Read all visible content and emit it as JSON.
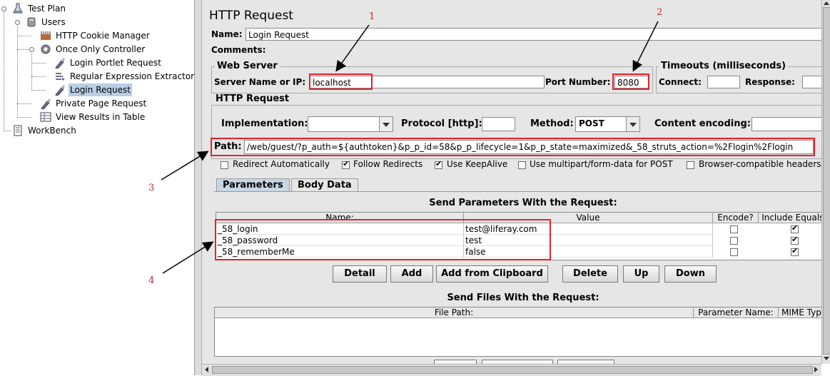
{
  "tree": {
    "items": [
      {
        "label": "Test Plan",
        "icon": "test-plan-icon"
      },
      {
        "label": "Users",
        "icon": "thread-group-icon"
      },
      {
        "label": "HTTP Cookie Manager",
        "icon": "cookie-manager-icon"
      },
      {
        "label": "Once Only Controller",
        "icon": "controller-icon"
      },
      {
        "label": "Login Portlet Request",
        "icon": "sampler-icon"
      },
      {
        "label": "Regular Expression Extractor",
        "icon": "extractor-icon"
      },
      {
        "label": "Login Request",
        "icon": "sampler-icon",
        "selected": true
      },
      {
        "label": "Private Page Request",
        "icon": "sampler-icon"
      },
      {
        "label": "View Results in Table",
        "icon": "listener-icon"
      },
      {
        "label": "WorkBench",
        "icon": "workbench-icon"
      }
    ]
  },
  "panel": {
    "title": "HTTP Request",
    "name_label": "Name:",
    "name_value": "Login Request",
    "comments_label": "Comments:",
    "web_server": {
      "title": "Web Server",
      "server_label": "Server Name or IP:",
      "server_value": "localhost",
      "port_label": "Port Number:",
      "port_value": "8080"
    },
    "timeouts": {
      "title": "Timeouts (milliseconds)",
      "connect_label": "Connect:",
      "response_label": "Response:"
    },
    "http_request": {
      "title": "HTTP Request",
      "impl_label": "Implementation:",
      "protocol_label": "Protocol [http]:",
      "method_label": "Method:",
      "method_value": "POST",
      "encoding_label": "Content encoding:",
      "path_label": "Path:",
      "path_value": "/web/guest/?p_auth=${authtoken}&p_p_id=58&p_p_lifecycle=1&p_p_state=maximized&_58_struts_action=%2Flogin%2Flogin"
    },
    "options": [
      {
        "label": "Redirect Automatically",
        "checked": false
      },
      {
        "label": "Follow Redirects",
        "checked": true
      },
      {
        "label": "Use KeepAlive",
        "checked": true
      },
      {
        "label": "Use multipart/form-data for POST",
        "checked": false
      },
      {
        "label": "Browser-compatible headers",
        "checked": false
      }
    ],
    "tabs": [
      "Parameters",
      "Body Data"
    ],
    "params_heading": "Send Parameters With the Request:",
    "params_columns": [
      "Name:",
      "Value",
      "Encode?",
      "Include Equals?"
    ],
    "params_rows": [
      {
        "name": "_58_login",
        "value": "test@liferay.com",
        "encode": false,
        "include": true
      },
      {
        "name": "_58_password",
        "value": "test",
        "encode": false,
        "include": true
      },
      {
        "name": "_58_rememberMe",
        "value": "false",
        "encode": false,
        "include": true
      }
    ],
    "buttons": [
      "Detail",
      "Add",
      "Add from Clipboard",
      "Delete",
      "Up",
      "Down"
    ],
    "files_heading": "Send Files With the Request:",
    "files_columns": [
      "File Path:",
      "Parameter Name:",
      "MIME Type"
    ]
  },
  "annotations": [
    "1",
    "2",
    "3",
    "4"
  ],
  "colors": {
    "annotation": "#e0242c",
    "selection": "#b8cfe5",
    "panel_bg": "#e6e6e6"
  }
}
